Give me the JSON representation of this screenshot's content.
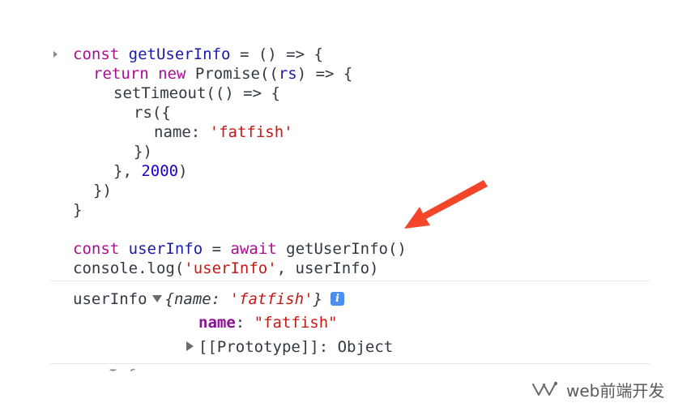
{
  "code": {
    "kw_const": "const",
    "fn_getUserInfo": "getUserInfo",
    "op_assign_arrow": " = () => {",
    "kw_return": "return",
    "kw_new": "new",
    "promise_ctor": "Promise",
    "paren_open": "((",
    "param_rs": "rs",
    "arrow_brace": ") => {",
    "set_timeout_line": "setTimeout(() => {",
    "rs_call_line": "rs({",
    "name_key": "name: ",
    "name_value": "'fatfish'",
    "close_rs": "})",
    "timeout_close_prefix": "}, ",
    "timeout_ms": "2000",
    "timeout_close_suffix": ")",
    "close_promise": "})",
    "close_fn": "}",
    "user_info_var": "userInfo",
    "assign_eq": " = ",
    "kw_await": "await",
    "call_get_user_info": " getUserInfo()",
    "console_log_prefix": "console.log(",
    "log_label_str": "'userInfo'",
    "log_args_suffix": ", userInfo)"
  },
  "output": {
    "label": "userInfo",
    "preview_open": "{",
    "preview_key": "name: ",
    "preview_value": "'fatfish'",
    "preview_close": "}",
    "info_badge": "i",
    "prop_key": "name",
    "prop_colon": ": ",
    "prop_value": "\"fatfish\"",
    "prototype_label": "[[Prototype]]: Object"
  },
  "truncated_text": "userInfo",
  "watermark": {
    "text": "web前端开发",
    "icon": "wechat-channel-icon"
  },
  "colors": {
    "keyword": "#aa0d91",
    "string": "#c41a16",
    "number": "#1c00cf",
    "arrow": "#f2452a",
    "info_badge": "#4a8ef0"
  }
}
